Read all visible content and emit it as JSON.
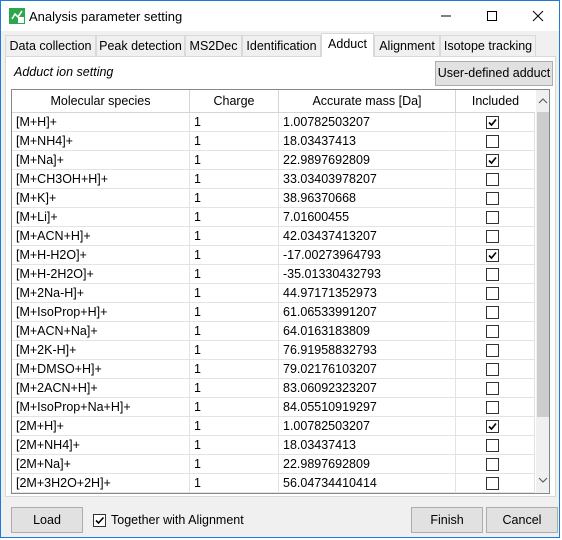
{
  "window": {
    "title": "Analysis parameter setting"
  },
  "tabs": [
    {
      "label": "Data collection"
    },
    {
      "label": "Peak detection"
    },
    {
      "label": "MS2Dec"
    },
    {
      "label": "Identification"
    },
    {
      "label": "Adduct"
    },
    {
      "label": "Alignment"
    },
    {
      "label": "Isotope tracking"
    }
  ],
  "active_tab": "Adduct",
  "panel": {
    "section_label": "Adduct ion setting",
    "user_defined_button": "User-defined adduct"
  },
  "grid": {
    "columns": [
      "Molecular species",
      "Charge",
      "Accurate mass [Da]",
      "Included"
    ],
    "rows": [
      {
        "species": "[M+H]+",
        "charge": "1",
        "mass": "1.00782503207",
        "included": true
      },
      {
        "species": "[M+NH4]+",
        "charge": "1",
        "mass": "18.03437413",
        "included": false
      },
      {
        "species": "[M+Na]+",
        "charge": "1",
        "mass": "22.9897692809",
        "included": true
      },
      {
        "species": "[M+CH3OH+H]+",
        "charge": "1",
        "mass": "33.03403978207",
        "included": false
      },
      {
        "species": "[M+K]+",
        "charge": "1",
        "mass": "38.96370668",
        "included": false
      },
      {
        "species": "[M+Li]+",
        "charge": "1",
        "mass": "7.01600455",
        "included": false
      },
      {
        "species": "[M+ACN+H]+",
        "charge": "1",
        "mass": "42.03437413207",
        "included": false
      },
      {
        "species": "[M+H-H2O]+",
        "charge": "1",
        "mass": "-17.00273964793",
        "included": true
      },
      {
        "species": "[M+H-2H2O]+",
        "charge": "1",
        "mass": "-35.01330432793",
        "included": false
      },
      {
        "species": "[M+2Na-H]+",
        "charge": "1",
        "mass": "44.97171352973",
        "included": false
      },
      {
        "species": "[M+IsoProp+H]+",
        "charge": "1",
        "mass": "61.06533991207",
        "included": false
      },
      {
        "species": "[M+ACN+Na]+",
        "charge": "1",
        "mass": "64.0163183809",
        "included": false
      },
      {
        "species": "[M+2K-H]+",
        "charge": "1",
        "mass": "76.91958832793",
        "included": false
      },
      {
        "species": "[M+DMSO+H]+",
        "charge": "1",
        "mass": "79.02176103207",
        "included": false
      },
      {
        "species": "[M+2ACN+H]+",
        "charge": "1",
        "mass": "83.06092323207",
        "included": false
      },
      {
        "species": "[M+IsoProp+Na+H]+",
        "charge": "1",
        "mass": "84.05510919297",
        "included": false
      },
      {
        "species": "[2M+H]+",
        "charge": "1",
        "mass": "1.00782503207",
        "included": true
      },
      {
        "species": "[2M+NH4]+",
        "charge": "1",
        "mass": "18.03437413",
        "included": false
      },
      {
        "species": "[2M+Na]+",
        "charge": "1",
        "mass": "22.9897692809",
        "included": false
      },
      {
        "species": "[2M+3H2O+2H]+",
        "charge": "1",
        "mass": "56.04734410414",
        "included": false
      }
    ]
  },
  "footer": {
    "load_button": "Load",
    "together_checkbox_label": "Together with Alignment",
    "together_checked": true,
    "finish_button": "Finish",
    "cancel_button": "Cancel"
  }
}
